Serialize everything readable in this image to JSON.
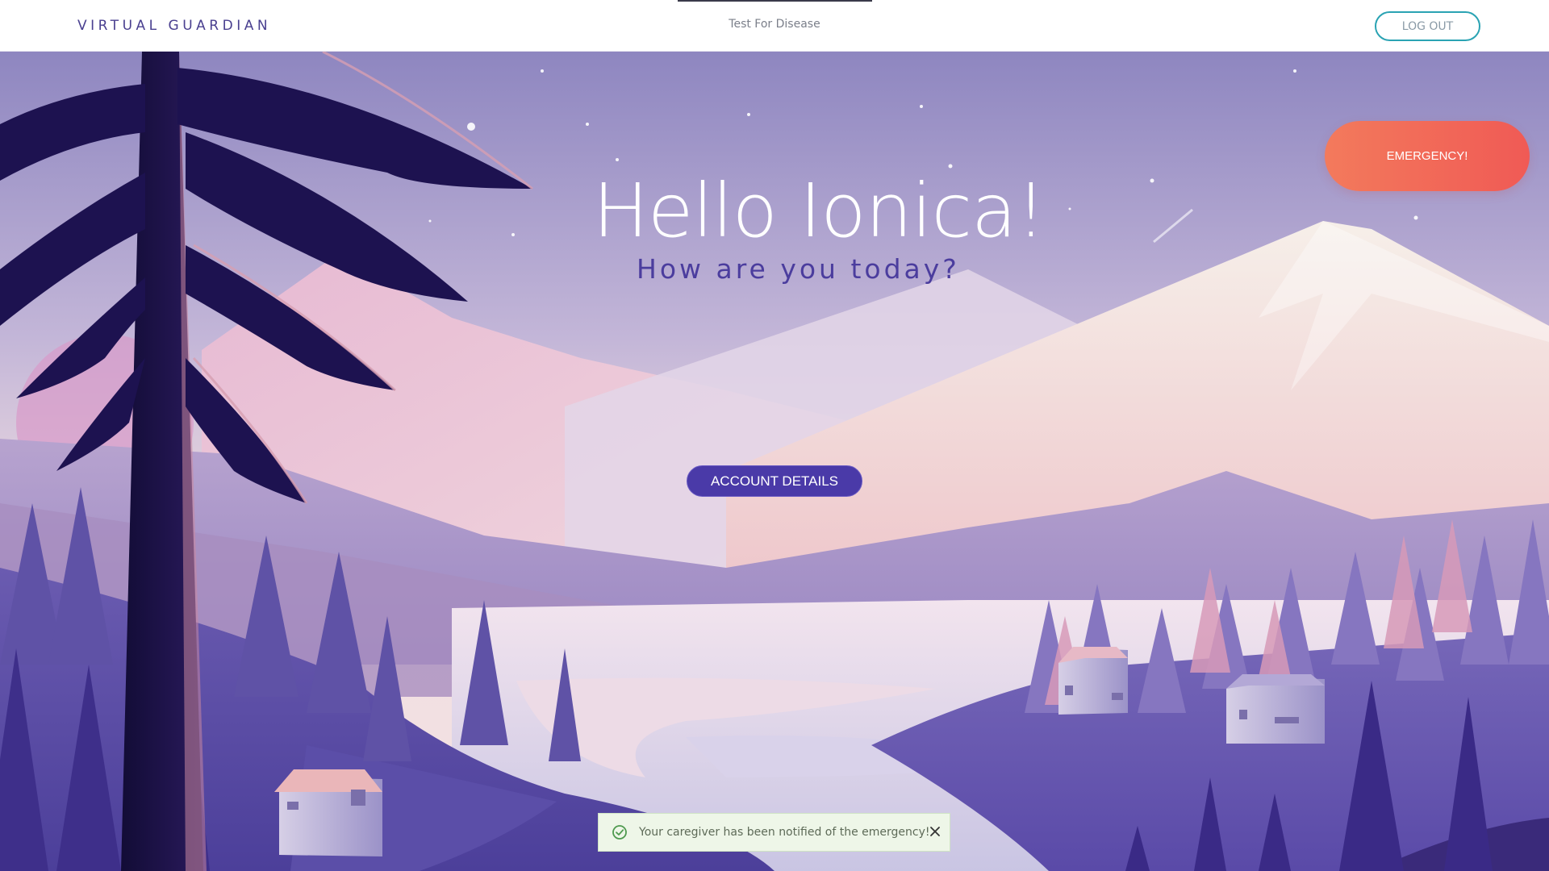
{
  "header": {
    "brand": "VIRTUAL GUARDIAN",
    "nav_link": "Test For Disease",
    "logout_label": "LOG OUT"
  },
  "hero": {
    "greeting": "Hello Ionica!",
    "subgreeting": "How are you today?",
    "emergency_label": "EMERGENCY!",
    "account_label": "ACCOUNT DETAILS"
  },
  "toast": {
    "message": "Your caregiver has been notified of the emergency!",
    "status": "success",
    "icon": "check-circle-icon",
    "close_icon": "close-icon"
  },
  "colors": {
    "brand": "#4a4090",
    "accent": "#4a3aa8",
    "emergency": "#f05a55",
    "logout_border": "#2aa3b3",
    "toast_bg": "#eef6e8"
  }
}
